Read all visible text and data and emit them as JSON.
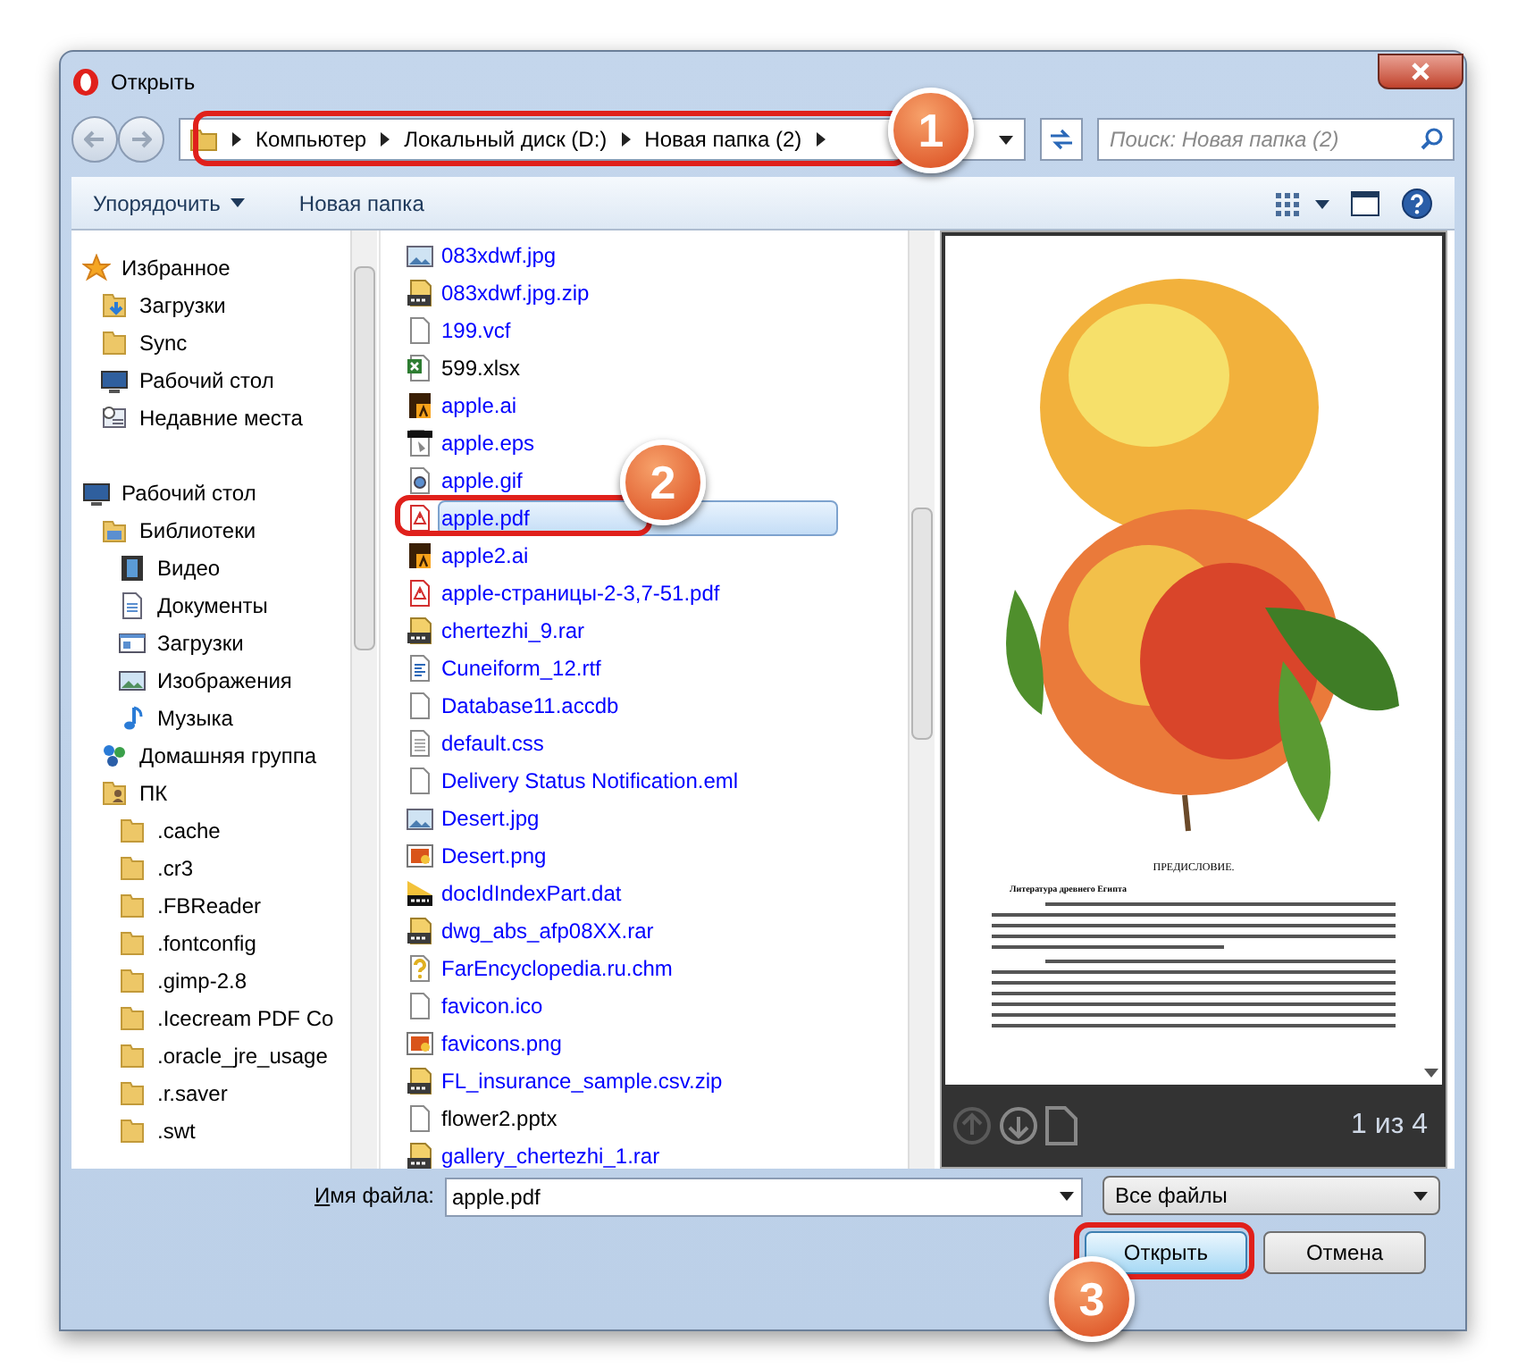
{
  "window": {
    "title": "Открыть"
  },
  "address": {
    "crumbs": [
      "Компьютер",
      "Локальный диск (D:)",
      "Новая папка (2)"
    ]
  },
  "search": {
    "placeholder": "Поиск: Новая папка (2)"
  },
  "toolbar": {
    "organize": "Упорядочить",
    "new_folder": "Новая папка"
  },
  "sidebar": {
    "items": [
      {
        "label": "Избранное",
        "kind": "star",
        "children": [
          {
            "label": "Загрузки",
            "kind": "folder-down"
          },
          {
            "label": "Sync",
            "kind": "folder"
          },
          {
            "label": "Рабочий стол",
            "kind": "desktop"
          },
          {
            "label": "Недавние места",
            "kind": "recent"
          }
        ]
      },
      {
        "label": "Рабочий стол",
        "kind": "desktop",
        "children": [
          {
            "label": "Библиотеки",
            "kind": "library",
            "children": [
              {
                "label": "Видео",
                "kind": "video"
              },
              {
                "label": "Документы",
                "kind": "doc"
              },
              {
                "label": "Загрузки",
                "kind": "window"
              },
              {
                "label": "Изображения",
                "kind": "image"
              },
              {
                "label": "Музыка",
                "kind": "music"
              }
            ]
          },
          {
            "label": "Домашняя группа",
            "kind": "homegroup"
          },
          {
            "label": "ПК",
            "kind": "user-folder",
            "children": [
              {
                "label": ".cache",
                "kind": "folder"
              },
              {
                "label": ".cr3",
                "kind": "folder"
              },
              {
                "label": ".FBReader",
                "kind": "folder"
              },
              {
                "label": ".fontconfig",
                "kind": "folder"
              },
              {
                "label": ".gimp-2.8",
                "kind": "folder"
              },
              {
                "label": ".Icecream PDF Co",
                "kind": "folder"
              },
              {
                "label": ".oracle_jre_usage",
                "kind": "folder"
              },
              {
                "label": ".r.saver",
                "kind": "folder"
              },
              {
                "label": ".swt",
                "kind": "folder"
              }
            ]
          }
        ]
      }
    ]
  },
  "files": [
    {
      "name": "083xdwf.jpg",
      "kind": "image",
      "compressed": true,
      "selected": false
    },
    {
      "name": "083xdwf.jpg.zip",
      "kind": "zip",
      "compressed": true,
      "selected": false
    },
    {
      "name": "199.vcf",
      "kind": "file",
      "compressed": true,
      "selected": false
    },
    {
      "name": "599.xlsx",
      "kind": "excel",
      "compressed": false,
      "selected": false
    },
    {
      "name": "apple.ai",
      "kind": "ai",
      "compressed": true,
      "selected": false
    },
    {
      "name": "apple.eps",
      "kind": "eps",
      "compressed": true,
      "selected": false
    },
    {
      "name": "apple.gif",
      "kind": "gif",
      "compressed": true,
      "selected": false
    },
    {
      "name": "apple.pdf",
      "kind": "pdf",
      "compressed": true,
      "selected": true
    },
    {
      "name": "apple2.ai",
      "kind": "ai",
      "compressed": true,
      "selected": false
    },
    {
      "name": "apple-страницы-2-3,7-51.pdf",
      "kind": "pdf",
      "compressed": true,
      "selected": false
    },
    {
      "name": "chertezhi_9.rar",
      "kind": "rar",
      "compressed": true,
      "selected": false
    },
    {
      "name": "Cuneiform_12.rtf",
      "kind": "rtf",
      "compressed": true,
      "selected": false
    },
    {
      "name": "Database11.accdb",
      "kind": "file",
      "compressed": true,
      "selected": false
    },
    {
      "name": "default.css",
      "kind": "text",
      "compressed": true,
      "selected": false
    },
    {
      "name": "Delivery Status Notification.eml",
      "kind": "file",
      "compressed": true,
      "selected": false
    },
    {
      "name": "Desert.jpg",
      "kind": "image",
      "compressed": true,
      "selected": false
    },
    {
      "name": "Desert.png",
      "kind": "png",
      "compressed": true,
      "selected": false
    },
    {
      "name": "docIdIndexPart.dat",
      "kind": "dat",
      "compressed": true,
      "selected": false
    },
    {
      "name": "dwg_abs_afp08XX.rar",
      "kind": "rar",
      "compressed": true,
      "selected": false
    },
    {
      "name": "FarEncyclopedia.ru.chm",
      "kind": "chm",
      "compressed": true,
      "selected": false
    },
    {
      "name": "favicon.ico",
      "kind": "file",
      "compressed": true,
      "selected": false
    },
    {
      "name": "favicons.png",
      "kind": "png",
      "compressed": true,
      "selected": false
    },
    {
      "name": "FL_insurance_sample.csv.zip",
      "kind": "zip",
      "compressed": true,
      "selected": false
    },
    {
      "name": "flower2.pptx",
      "kind": "file",
      "compressed": false,
      "selected": false
    },
    {
      "name": "gallery_chertezhi_1.rar",
      "kind": "rar",
      "compressed": true,
      "selected": false
    }
  ],
  "preview": {
    "doc_title": "ПРЕДИСЛОВИЕ.",
    "doc_heading": "Литература древнего Египта",
    "page_counter": "1 из 4"
  },
  "bottom": {
    "filename_label": "Имя файла:",
    "filename": "apple.pdf",
    "filter": "Все файлы",
    "open": "Открыть",
    "cancel": "Отмена"
  },
  "callouts": [
    "1",
    "2",
    "3"
  ]
}
